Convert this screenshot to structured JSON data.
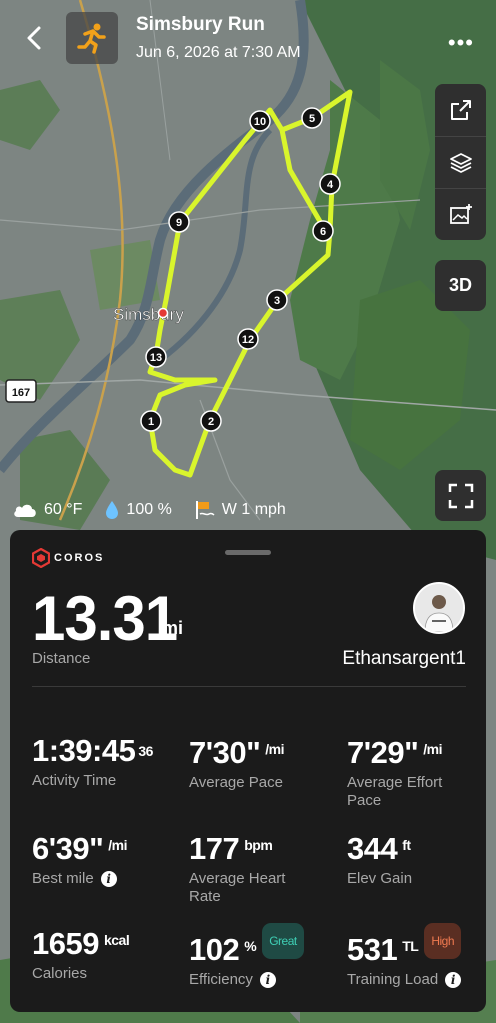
{
  "header": {
    "title": "Simsbury Run",
    "subtitle": "Jun 6, 2026 at 7:30 AM",
    "more_label": "•••"
  },
  "map": {
    "town_label": "Simsbury",
    "route_shield": "167",
    "route_color": "#d9f52c",
    "markers": [
      "1",
      "2",
      "3",
      "4",
      "5",
      "6",
      "9",
      "10",
      "12",
      "13"
    ],
    "toolbar": {
      "btn_3d": "3D"
    }
  },
  "weather": {
    "temperature": "60 °F",
    "humidity": "100 %",
    "wind": "W 1 mph"
  },
  "panel": {
    "logo": "COROS",
    "distance": {
      "value": "13.31",
      "unit": "mi",
      "label": "Distance"
    },
    "username": "Ethansargent1",
    "stats": [
      {
        "value": "1:39:45",
        "sup": "36",
        "unit": "",
        "label": "Activity Time"
      },
      {
        "value": "7'30\"",
        "unit": "/mi",
        "label": "Average Pace"
      },
      {
        "value": "7'29\"",
        "unit": "/mi",
        "label": "Average Effort Pace"
      },
      {
        "value": "6'39\"",
        "unit": "/mi",
        "label": "Best mile"
      },
      {
        "value": "177",
        "unit": "bpm",
        "label": "Average Heart Rate"
      },
      {
        "value": "344",
        "unit": "ft",
        "label": "Elev Gain"
      },
      {
        "value": "1659",
        "unit": "kcal",
        "label": "Calories"
      },
      {
        "value": "102",
        "unit": "%",
        "badge": "Great",
        "label": "Efficiency"
      },
      {
        "value": "531",
        "unit": "TL",
        "badge": "High",
        "label": "Training Load"
      }
    ]
  }
}
